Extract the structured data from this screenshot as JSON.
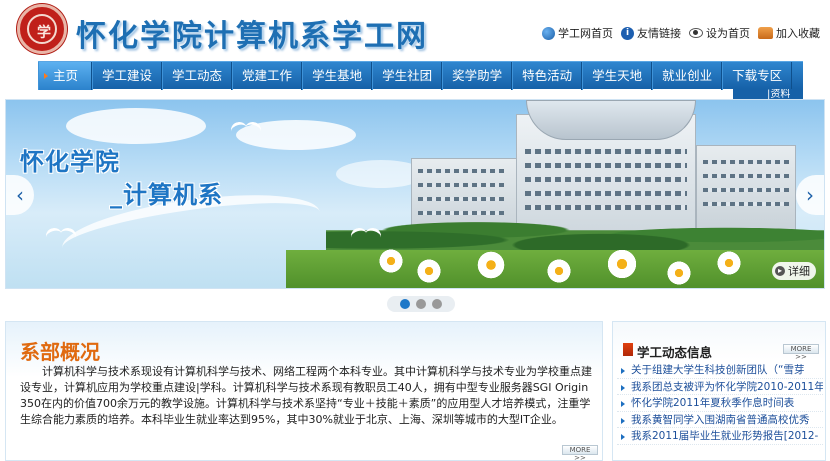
{
  "header": {
    "logo_glyph": "学",
    "site_title": "怀化学院计算机系学工网",
    "top_links": [
      {
        "label": "学工网首页",
        "icon": "home-globe-icon"
      },
      {
        "label": "友情链接",
        "icon": "info-icon"
      },
      {
        "label": "设为首页",
        "icon": "eye-icon"
      },
      {
        "label": "加入收藏",
        "icon": "favorites-icon"
      }
    ]
  },
  "nav": {
    "items": [
      "主页",
      "学工建设",
      "学工动态",
      "党建工作",
      "学生基地",
      "学生社团",
      "奖学助学",
      "特色活动",
      "学生天地",
      "就业创业",
      "下载专区"
    ],
    "overflow_label": "|资料"
  },
  "banner": {
    "text_line1": "怀化学院",
    "text_line2": "_计算机系",
    "prev_arrow": "‹",
    "next_arrow": "›",
    "detail_label": "详细",
    "detail_icon": "play-icon"
  },
  "slider": {
    "count": 3,
    "active": 1
  },
  "intro": {
    "title": "系部概况",
    "body": "计算机科学与技术系现设有计算机科学与技术、网络工程两个本科专业。其中计算机科学与技术专业为学校重点建设专业，计算机应用为学校重点建设|学科。计算机科学与技术系现有教职员工40人，拥有中型专业服务器SGI Origin 350在内的价值700余万元的教学设施。计算机科学与技术系坚持“专业＋技能＋素质”的应用型人才培养模式，注重学生综合能力素质的培养。本科毕业生就业率达到95%，其中30%就业于北京、上海、深圳等城市的大型IT企业。",
    "more_label": "MORE >>"
  },
  "news": {
    "title": "学工动态信息",
    "more_label": "MORE >>",
    "items": [
      "关于组建大学生科技创新团队（“雪芽",
      "我系团总支被评为怀化学院2010-2011年",
      "怀化学院2011年夏秋季作息时间表",
      "我系黄智同学入围湖南省普通高校优秀",
      "我系2011届毕业生就业形势报告[2012-"
    ]
  },
  "colors": {
    "brand_blue": "#1e6fb3",
    "nav_blue": "#1661a8",
    "accent_orange": "#e06a10",
    "link_blue": "#1d4f9a"
  }
}
